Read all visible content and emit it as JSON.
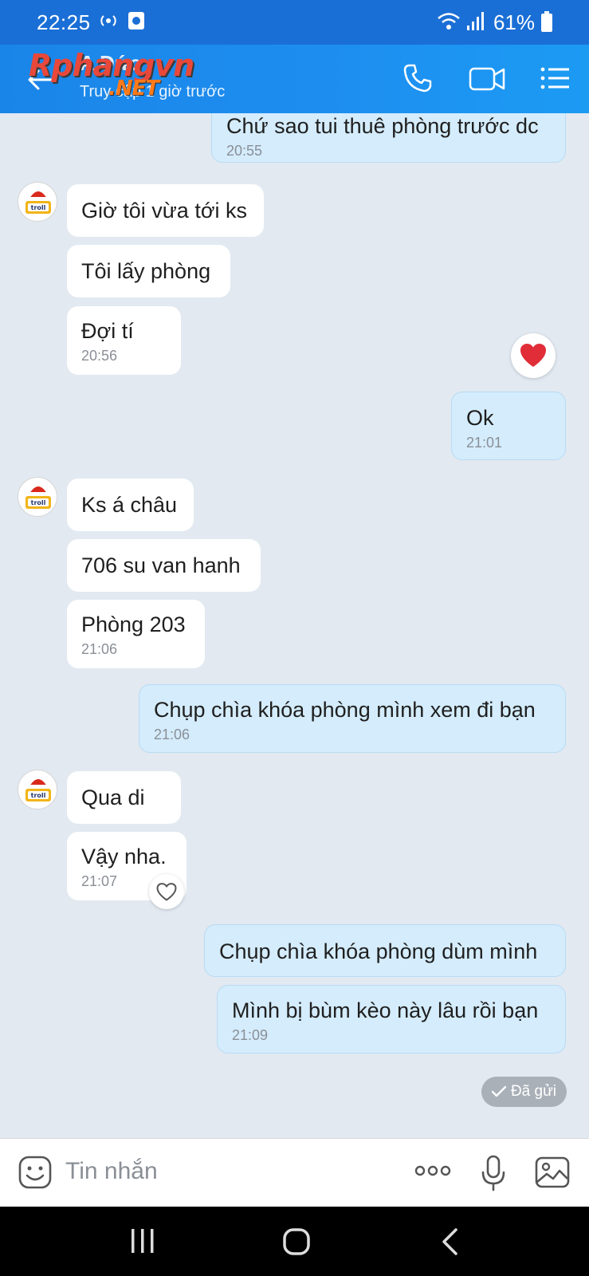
{
  "status_bar": {
    "time": "22:25",
    "battery": "61%",
    "icons": [
      "hotspot-icon",
      "screen-record-icon",
      "wifi-icon",
      "signal-icon",
      "battery-icon"
    ]
  },
  "header": {
    "contact_name": "A Đức",
    "last_seen": "Truy cập 1 giờ trước",
    "watermark": "Rphangvn",
    "watermark_sub": ".NET"
  },
  "messages": [
    {
      "side": "out",
      "text": "Chứ sao tui thuê phòng trước dc",
      "time": "20:55"
    },
    {
      "side": "in",
      "text": "Giờ tôi vừa tới ks",
      "time": ""
    },
    {
      "side": "in",
      "text": "Tôi lấy phòng",
      "time": ""
    },
    {
      "side": "in",
      "text": "Đợi tí",
      "time": "20:56"
    },
    {
      "side": "out",
      "text": "Ok",
      "time": "21:01"
    },
    {
      "side": "in",
      "text": "Ks á châu",
      "time": ""
    },
    {
      "side": "in",
      "text": "706 su van hanh",
      "time": ""
    },
    {
      "side": "in",
      "text": "Phòng 203",
      "time": "21:06"
    },
    {
      "side": "out",
      "text": "Chụp chìa khóa phòng mình xem đi bạn",
      "time": "21:06"
    },
    {
      "side": "in",
      "text": "Qua di",
      "time": ""
    },
    {
      "side": "in",
      "text": "Vậy nha.",
      "time": "21:07"
    },
    {
      "side": "out",
      "text": "Chụp chìa khóa phòng dùm mình",
      "time": ""
    },
    {
      "side": "out",
      "text": "Mình bị bùm kèo này lâu rồi bạn",
      "time": "21:09"
    }
  ],
  "avatar_label": "troll",
  "sent_status": "Đã gửi",
  "input": {
    "placeholder": "Tin nhắn"
  },
  "colors": {
    "header": "#1a85e8",
    "outgoing_bubble": "#d4ecfc",
    "incoming_bubble": "#ffffff",
    "chat_bg": "#e2e9f1"
  }
}
